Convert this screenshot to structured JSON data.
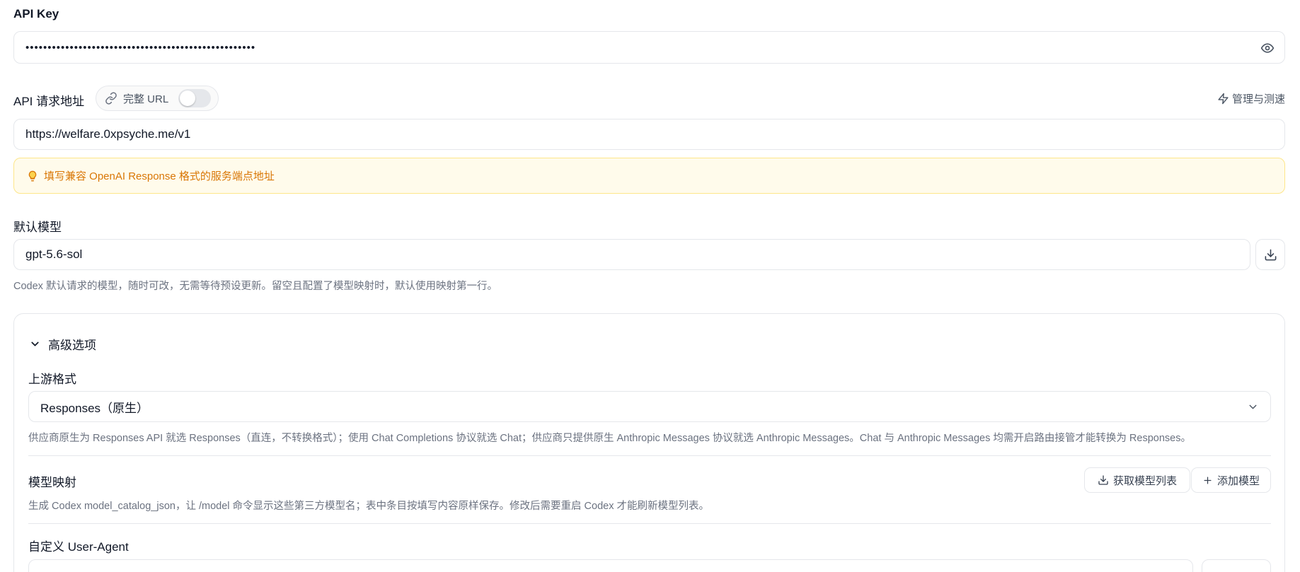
{
  "api_key": {
    "label": "API Key",
    "value": "••••••••••••••••••••••••••••••••••••••••••••••••••••",
    "toggle_visibility_icon": "eye-icon"
  },
  "api_url": {
    "label": "API 请求地址",
    "full_url_label": "完整 URL",
    "full_url_enabled": false,
    "manage_label": "管理与测速",
    "value": "https://welfare.0xpsyche.me/v1",
    "notice": "填写兼容 OpenAI Response 格式的服务端点地址"
  },
  "default_model": {
    "label": "默认模型",
    "value": "gpt-5.6-sol",
    "hint": "Codex 默认请求的模型，随时可改，无需等待预设更新。留空且配置了模型映射时，默认使用映射第一行。"
  },
  "advanced": {
    "title": "高级选项",
    "upstream_format": {
      "label": "上游格式",
      "selected": "Responses（原生）",
      "hint": "供应商原生为 Responses API 就选 Responses（直连，不转换格式）；使用 Chat Completions 协议就选 Chat；供应商只提供原生 Anthropic Messages 协议就选 Anthropic Messages。Chat 与 Anthropic Messages 均需开启路由接管才能转换为 Responses。"
    },
    "model_mapping": {
      "label": "模型映射",
      "fetch_button": "获取模型列表",
      "add_button": "添加模型",
      "hint": "生成 Codex model_catalog_json，让 /model 命令显示这些第三方模型名；表中条目按填写内容原样保存。修改后需要重启 Codex 才能刷新模型列表。"
    },
    "user_agent": {
      "label": "自定义 User-Agent"
    }
  },
  "colors": {
    "notice_text": "#d97706",
    "notice_bg": "#fffbeb",
    "border": "#e5e7eb"
  }
}
